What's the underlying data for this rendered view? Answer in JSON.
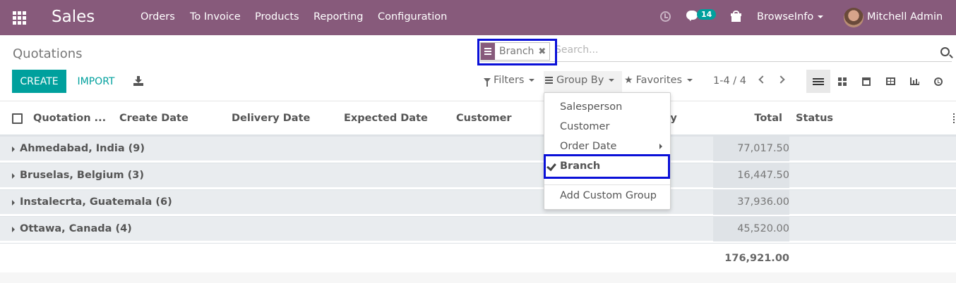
{
  "navbar": {
    "app_name": "Sales",
    "menu": [
      "Orders",
      "To Invoice",
      "Products",
      "Reporting",
      "Configuration"
    ],
    "messages_count": "14",
    "company": "BrowseInfo",
    "user": "Mitchell Admin",
    "bg_color": "#875a7b"
  },
  "control_panel": {
    "title": "Quotations",
    "search": {
      "facet_label": "Branch",
      "facet_icon": "group-by-icon",
      "placeholder": "Search..."
    },
    "create_label": "CREATE",
    "import_label": "IMPORT",
    "filters_label": "Filters",
    "group_by_label": "Group By",
    "favorites_label": "Favorites",
    "pager": "1-4 / 4",
    "views": [
      "list",
      "kanban",
      "calendar",
      "pivot",
      "graph",
      "activity"
    ],
    "accent_color": "#00a09d"
  },
  "table": {
    "columns": [
      "Quotation ...",
      "Create Date",
      "Delivery Date",
      "Expected Date",
      "Customer",
      "ny",
      "Total",
      "Status"
    ],
    "groups": [
      {
        "label": "Ahmedabad, India (9)",
        "total": "77,017.50"
      },
      {
        "label": "Bruselas, Belgium (3)",
        "total": "16,447.50"
      },
      {
        "label": "Instalecrta, Guatemala (6)",
        "total": "37,936.00"
      },
      {
        "label": "Ottawa, Canada (4)",
        "total": "45,520.00"
      }
    ],
    "grand_total": "176,921.00"
  },
  "group_by_menu": {
    "items": [
      "Salesperson",
      "Customer",
      "Order Date",
      "Branch"
    ],
    "selected": "Branch",
    "add_custom": "Add Custom Group"
  }
}
